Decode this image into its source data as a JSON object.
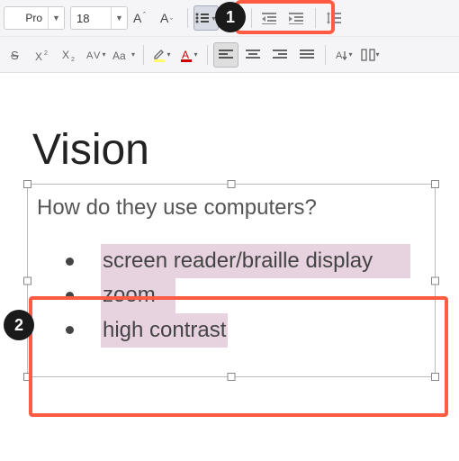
{
  "toolbar": {
    "row1": {
      "fontNameVisible": "Pro",
      "fontSize": "18"
    }
  },
  "markers": {
    "one": "1",
    "two": "2"
  },
  "doc": {
    "title": "Vision",
    "subtitle": "How do they use computers?",
    "bullets": [
      "screen reader/braille display",
      "zoom",
      "high contrast"
    ]
  },
  "colors": {
    "highlight": "#ff5a42",
    "selection": "#e7d3e0"
  }
}
